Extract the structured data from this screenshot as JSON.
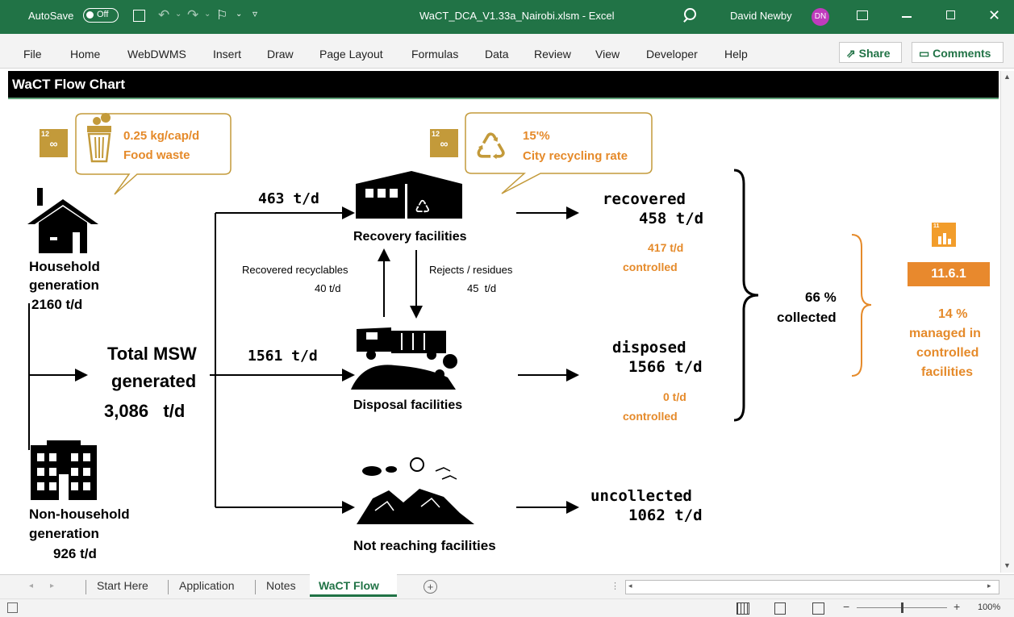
{
  "window": {
    "autosave_label": "AutoSave",
    "autosave_state": "Off",
    "file_title": "WaCT_DCA_V1.33a_Nairobi.xlsm  -  Excel",
    "user_name": "David Newby",
    "user_initials": "DN"
  },
  "menu": {
    "items": [
      "File",
      "Home",
      "WebDWMS",
      "Insert",
      "Draw",
      "Page Layout",
      "Formulas",
      "Data",
      "Review",
      "View",
      "Developer",
      "Help"
    ],
    "share_label": "Share",
    "comments_label": "Comments"
  },
  "sheet": {
    "banner_title": "WaCT Flow Chart",
    "callouts": {
      "food_rate": "0.25 kg/cap/d",
      "food_label": "Food waste",
      "recycling_rate": "15'%",
      "recycling_label": "City recycling rate"
    },
    "household": {
      "label_line1": "Household",
      "label_line2": "generation",
      "value": "2160 t/d"
    },
    "nonhousehold": {
      "label_line1": "Non-household",
      "label_line2": "generation",
      "value": "926 t/d"
    },
    "total": {
      "line1": "Total MSW",
      "line2": "generated",
      "value": "3,086   t/d"
    },
    "flows": {
      "to_recovery": "463 t/d",
      "to_disposal": "1561 t/d"
    },
    "recovery_label": "Recovery facilities",
    "disposal_label": "Disposal facilities",
    "not_reaching_label": "Not reaching facilities",
    "recovered_recyclables": {
      "label": "Recovered recyclables",
      "value": "40 t/d"
    },
    "rejects": {
      "label": "Rejects / residues",
      "value": "45  t/d"
    },
    "recovered": {
      "label": "recovered",
      "value": "458 t/d",
      "controlled_value": "417 t/d",
      "controlled_label": "controlled"
    },
    "disposed": {
      "label": "disposed",
      "value": "1566 t/d",
      "controlled_value": "0 t/d",
      "controlled_label": "controlled"
    },
    "uncollected": {
      "label": "uncollected",
      "value": "1062 t/d"
    },
    "collected": {
      "value": "66 %",
      "label": "collected"
    },
    "sdg_indicator": "11.6.1",
    "managed": {
      "value": "14 %",
      "line1": "managed in",
      "line2": "controlled",
      "line3": "facilities"
    }
  },
  "tabs": {
    "items": [
      "Start Here",
      "Application",
      "Notes",
      "WaCT Flow"
    ],
    "active": "WaCT Flow"
  },
  "status": {
    "zoom": "100%"
  },
  "colors": {
    "excel_green": "#217346",
    "orange": "#e58a2a",
    "sdg12_gold": "#c39a3a"
  }
}
